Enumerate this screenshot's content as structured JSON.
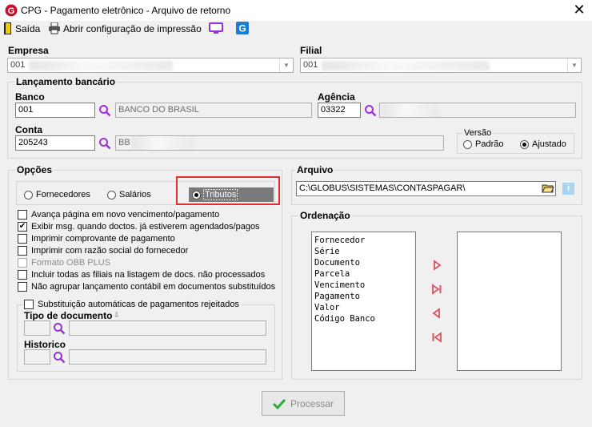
{
  "window": {
    "title": "CPG - Pagamento eletrônico - Arquivo de retorno",
    "close_glyph": "✕"
  },
  "toolbar": {
    "exit_label": "Saída",
    "print_config_label": "Abrir configuração de impressão"
  },
  "empresa": {
    "label": "Empresa",
    "value": "001"
  },
  "filial": {
    "label": "Filial",
    "value": "001"
  },
  "lancamento": {
    "title": "Lançamento bancário",
    "banco_label": "Banco",
    "banco_code": "001",
    "banco_name": "BANCO DO BRASIL",
    "agencia_label": "Agência",
    "agencia_code": "03322",
    "conta_label": "Conta",
    "conta_code": "205243",
    "conta_name": "BB",
    "versao": {
      "title": "Versão",
      "options": [
        "Padrão",
        "Ajustado"
      ],
      "selected": "Ajustado"
    }
  },
  "opcoes": {
    "title": "Opções",
    "radios": [
      "Fornecedores",
      "Salários",
      "Tributos"
    ],
    "selected": "Tributos",
    "checks": [
      {
        "label": "Avança página em novo vencimento/pagamento",
        "checked": false,
        "enabled": true
      },
      {
        "label": "Exibir msg. quando doctos. já estiverem agendados/pagos",
        "checked": true,
        "enabled": true
      },
      {
        "label": "Imprimir comprovante de pagamento",
        "checked": false,
        "enabled": true
      },
      {
        "label": "Imprimir com razão social do fornecedor",
        "checked": false,
        "enabled": true
      },
      {
        "label": "Formato OBB PLUS",
        "checked": false,
        "enabled": false
      },
      {
        "label": "Incluir todas as filiais na listagem de docs. não processados",
        "checked": false,
        "enabled": true
      },
      {
        "label": "Não agrupar lançamento contábil em documentos substituídos",
        "checked": false,
        "enabled": true
      }
    ],
    "substituicao": {
      "label": "Substituição automáticas de pagamentos rejeitados",
      "tipo_doc_label": "Tipo de documento",
      "historico_label": "Historico"
    }
  },
  "arquivo": {
    "title": "Arquivo",
    "path": "C:\\GLOBUS\\SISTEMAS\\CONTASPAGAR\\"
  },
  "ordenacao": {
    "title": "Ordenação",
    "available": [
      "Fornecedor",
      "Série",
      "Documento",
      "Parcela",
      "Vencimento",
      "Pagamento",
      "Valor",
      "Código Banco"
    ],
    "selected": []
  },
  "footer": {
    "process_label": "Processar"
  },
  "colors": {
    "accent_purple": "#9b30d9",
    "highlight_red": "#e03030",
    "arrow_red": "#e05060",
    "check_green": "#2eaa3c"
  }
}
